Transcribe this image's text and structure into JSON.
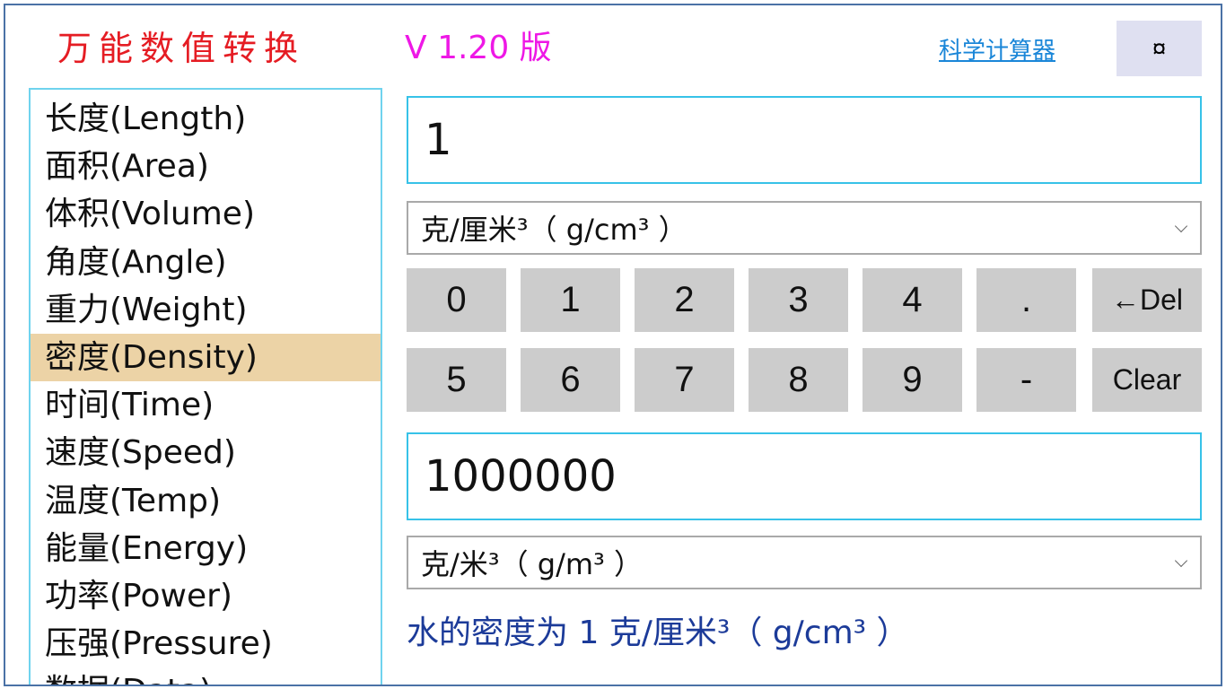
{
  "header": {
    "title": "万能数值转换",
    "version": "V 1.20 版",
    "calculator_link": "科学计算器",
    "settings_glyph": "¤"
  },
  "categories": [
    {
      "label": "长度(Length)"
    },
    {
      "label": "面积(Area)"
    },
    {
      "label": "体积(Volume)"
    },
    {
      "label": "角度(Angle)"
    },
    {
      "label": "重力(Weight)"
    },
    {
      "label": "密度(Density)",
      "selected": true
    },
    {
      "label": "时间(Time)"
    },
    {
      "label": "速度(Speed)"
    },
    {
      "label": "温度(Temp)"
    },
    {
      "label": "能量(Energy)"
    },
    {
      "label": "功率(Power)"
    },
    {
      "label": "压强(Pressure)"
    },
    {
      "label": "数据(Data)"
    }
  ],
  "converter": {
    "input_value": "1",
    "input_unit": "克/厘米³（ g/cm³ ）",
    "output_value": "1000000",
    "output_unit": "克/米³（ g/m³ ）",
    "info": "水的密度为 1 克/厘米³（ g/cm³ ）"
  },
  "keypad": {
    "row1": [
      "0",
      "1",
      "2",
      "3",
      "4",
      ".",
      "←Del"
    ],
    "row2": [
      "5",
      "6",
      "7",
      "8",
      "9",
      "-",
      "Clear"
    ]
  },
  "colors": {
    "title": "#e51c23",
    "version": "#ee18e6",
    "link": "#1a86d8",
    "selected_category": "#ecd3a6",
    "input_border": "#37c2e8",
    "info_text": "#1c3b99",
    "key_background": "#cccccc"
  }
}
